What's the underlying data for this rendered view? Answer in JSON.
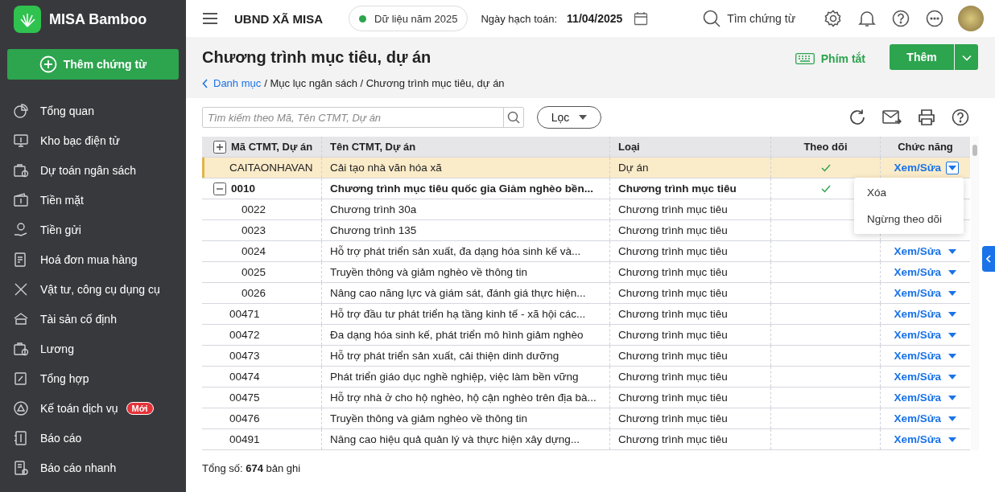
{
  "app": {
    "name": "MISA Bamboo",
    "new_voucher_button": "Thêm chứng từ"
  },
  "sidebar": {
    "items": [
      {
        "label": "Tổng quan"
      },
      {
        "label": "Kho bạc điện tử"
      },
      {
        "label": "Dự toán ngân sách"
      },
      {
        "label": "Tiền mặt"
      },
      {
        "label": "Tiền gửi"
      },
      {
        "label": "Hoá đơn mua hàng"
      },
      {
        "label": "Vật tư, công cụ dụng cụ"
      },
      {
        "label": "Tài sản cố định"
      },
      {
        "label": "Lương"
      },
      {
        "label": "Tổng hợp"
      },
      {
        "label": "Kế toán dịch vụ",
        "badge": "Mới"
      },
      {
        "label": "Báo cáo"
      },
      {
        "label": "Báo cáo nhanh"
      }
    ]
  },
  "header": {
    "org": "UBND XÃ MISA",
    "data_year": "Dữ liệu năm 2025",
    "posting_date_label": "Ngày hạch toán:",
    "posting_date": "11/04/2025",
    "search_label": "Tìm chứng từ"
  },
  "page": {
    "title": "Chương trình mục tiêu, dự án",
    "breadcrumb_link": "Danh mục",
    "breadcrumb_path": "/ Mục lục ngân sách / Chương trình mục tiêu, dự án",
    "shortcut_button": "Phím tắt",
    "add_button": "Thêm"
  },
  "toolbar": {
    "search": {
      "placeholder": "Tìm kiếm theo Mã, Tên CTMT, Dự án"
    },
    "filter_button": "Lọc"
  },
  "table": {
    "columns": [
      "Mã CTMT, Dự án",
      "Tên CTMT, Dự án",
      "Loại",
      "Theo dõi",
      "Chức năng"
    ],
    "rows": [
      {
        "code": "CAITAONHAVAN",
        "name": "Cải tạo nhà văn hóa xã",
        "type": "Dự án",
        "followed": true,
        "action": "Xem/Sửa",
        "selected": true,
        "menu_open": true
      },
      {
        "code": "0010",
        "name": "Chương trình mục tiêu quốc gia Giảm nghèo bền...",
        "type": "Chương trình mục tiêu",
        "followed": true,
        "selected": false,
        "menu_open": false,
        "expanded": true,
        "children": [
          {
            "code": "0022",
            "name": "Chương trình 30a",
            "type": "Chương trình mục tiêu",
            "followed": false,
            "selected": false,
            "menu_open": false
          },
          {
            "code": "0023",
            "name": "Chương trình 135",
            "type": "Chương trình mục tiêu",
            "followed": false,
            "selected": false,
            "menu_open": false
          },
          {
            "code": "0024",
            "name": "Hỗ trợ phát triển sản xuất, đa dạng hóa sinh kế và...",
            "type": "Chương trình mục tiêu",
            "followed": false,
            "action": "Xem/Sửa",
            "selected": false,
            "menu_open": false
          },
          {
            "code": "0025",
            "name": "Truyền thông và giảm nghèo về thông tin",
            "type": "Chương trình mục tiêu",
            "followed": false,
            "action": "Xem/Sửa",
            "selected": false,
            "menu_open": false
          },
          {
            "code": "0026",
            "name": "Nâng cao năng lực và giám sát, đánh giá thực hiện...",
            "type": "Chương trình mục tiêu",
            "followed": false,
            "action": "Xem/Sửa",
            "selected": false,
            "menu_open": false
          }
        ]
      },
      {
        "code": "00471",
        "name": "Hỗ trợ đầu tư phát triển hạ tầng kinh tế - xã hội các...",
        "type": "Chương trình mục tiêu",
        "followed": false,
        "action": "Xem/Sửa",
        "selected": false,
        "menu_open": false
      },
      {
        "code": "00472",
        "name": "Đa dạng hóa sinh kế, phát triển mô hình giảm nghèo",
        "type": "Chương trình mục tiêu",
        "followed": false,
        "action": "Xem/Sửa",
        "selected": false,
        "menu_open": false
      },
      {
        "code": "00473",
        "name": "Hỗ trợ phát triển sản xuất, cải thiện dinh dưỡng",
        "type": "Chương trình mục tiêu",
        "followed": false,
        "action": "Xem/Sửa",
        "selected": false,
        "menu_open": false
      },
      {
        "code": "00474",
        "name": "Phát triển giáo dục nghề nghiệp, việc làm bền vững",
        "type": "Chương trình mục tiêu",
        "followed": false,
        "action": "Xem/Sửa",
        "selected": false,
        "menu_open": false
      },
      {
        "code": "00475",
        "name": "Hỗ trợ nhà ở cho hộ nghèo, hộ cận nghèo trên địa bà...",
        "type": "Chương trình mục tiêu",
        "followed": false,
        "action": "Xem/Sửa",
        "selected": false,
        "menu_open": false
      },
      {
        "code": "00476",
        "name": "Truyền thông và giảm nghèo về thông tin",
        "type": "Chương trình mục tiêu",
        "followed": false,
        "action": "Xem/Sửa",
        "selected": false,
        "menu_open": false
      },
      {
        "code": "00491",
        "name": "Nâng cao hiệu quả quản lý và thực hiện xây dựng...",
        "type": "Chương trình mục tiêu",
        "followed": false,
        "action": "Xem/Sửa",
        "selected": false,
        "menu_open": false
      }
    ]
  },
  "row_menu": {
    "items": [
      "Xóa",
      "Ngừng theo dõi"
    ]
  },
  "footer": {
    "total": "Tổng số:  **674** bản ghi"
  }
}
